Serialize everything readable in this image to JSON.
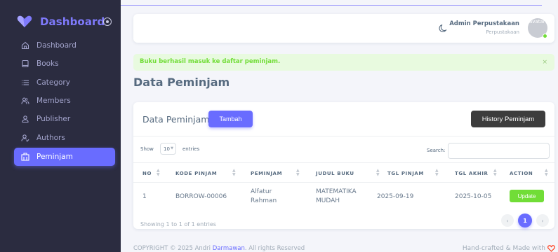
{
  "sidebar": {
    "brand": "Dashboard",
    "items": [
      {
        "label": "Dashboard",
        "icon": "home-icon"
      },
      {
        "label": "Books",
        "icon": "book-icon"
      },
      {
        "label": "Category",
        "icon": "list-icon"
      },
      {
        "label": "Members",
        "icon": "users-icon"
      },
      {
        "label": "Publisher",
        "icon": "user-icon"
      },
      {
        "label": "Authors",
        "icon": "user-check-icon"
      },
      {
        "label": "Peminjam",
        "icon": "building-icon",
        "active": true
      }
    ]
  },
  "navbar": {
    "user_name": "Admin Perpustakaan",
    "user_role": "Perpustakaan",
    "avatar_alt": "avatar"
  },
  "alert": {
    "message": "Buku berhasil masuk ke daftar peminjam.",
    "close": "×"
  },
  "page": {
    "title": "Data Peminjam"
  },
  "card": {
    "title": "Data Peminjam",
    "add_button": "Tambah",
    "history_button": "History Peminjam",
    "show_label": "Show",
    "entries_value": "10",
    "entries_label": "entries",
    "search_label": "Search:",
    "search_value": ""
  },
  "table": {
    "headers": [
      "NO",
      "KODE PINJAM",
      "PEMINJAM",
      "JUDUL BUKU",
      "TGL PINJAM",
      "TGL AKHIR",
      "ACTION"
    ],
    "rows": [
      {
        "no": "1",
        "kode": "BORROW-00006",
        "peminjam_1": "Alfatur",
        "peminjam_2": "Rahman",
        "judul_1": "MATEMATIKA",
        "judul_2": "MUDAH",
        "tgl_pinjam": "2025-09-19",
        "tgl_akhir": "2025-10-05",
        "action": "Update"
      }
    ],
    "info": "Showing 1 to 1 of 1 entries",
    "pagination": {
      "prev": "‹",
      "current": "1",
      "next": "›"
    }
  },
  "footer": {
    "left_prefix": "COPYRIGHT © 2025 Andri ",
    "left_author": "Darmawan",
    "left_suffix": ". All rights Reserved",
    "right": "Hand-crafted & Made with"
  },
  "colors": {
    "sidebar_bg": "#2b2c40",
    "primary": "#696cff",
    "success": "#71dd37",
    "alert_bg": "#e8fadf",
    "dark_button": "#3d3d3d"
  }
}
